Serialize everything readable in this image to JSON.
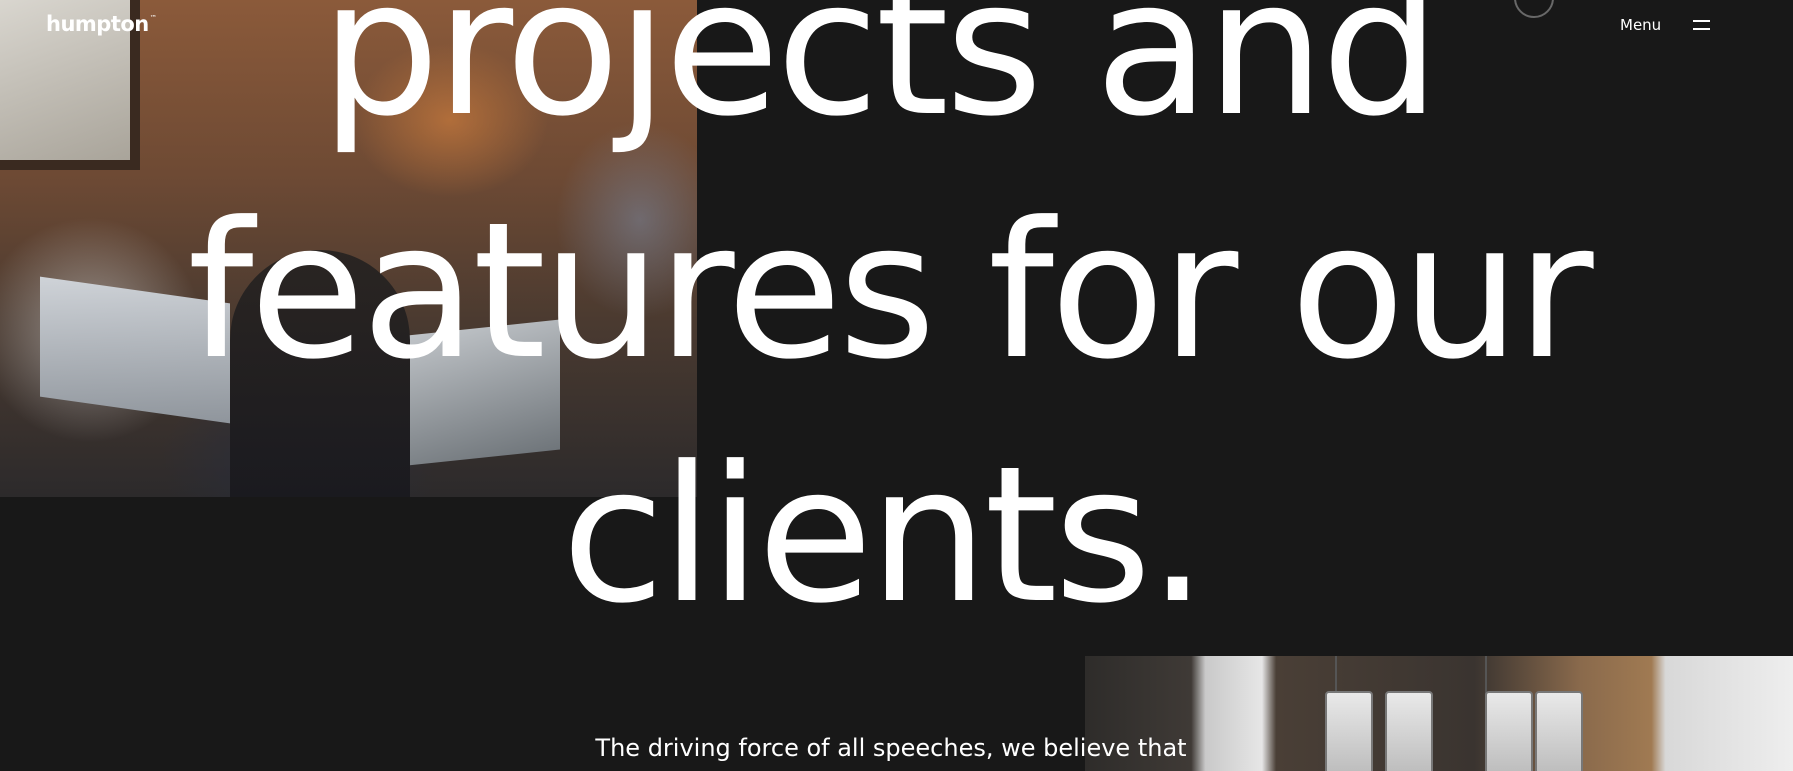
{
  "brand": {
    "logo_text": "humpton",
    "logo_mark": "™"
  },
  "nav": {
    "menu_label": "Menu",
    "menu_icon": "hamburger-icon"
  },
  "hero": {
    "headline_lines": [
      "projects and",
      "features for our",
      "clients."
    ],
    "subtext": "The driving force of all speeches, we believe that"
  },
  "colors": {
    "background": "#181818",
    "text": "#ffffff"
  }
}
